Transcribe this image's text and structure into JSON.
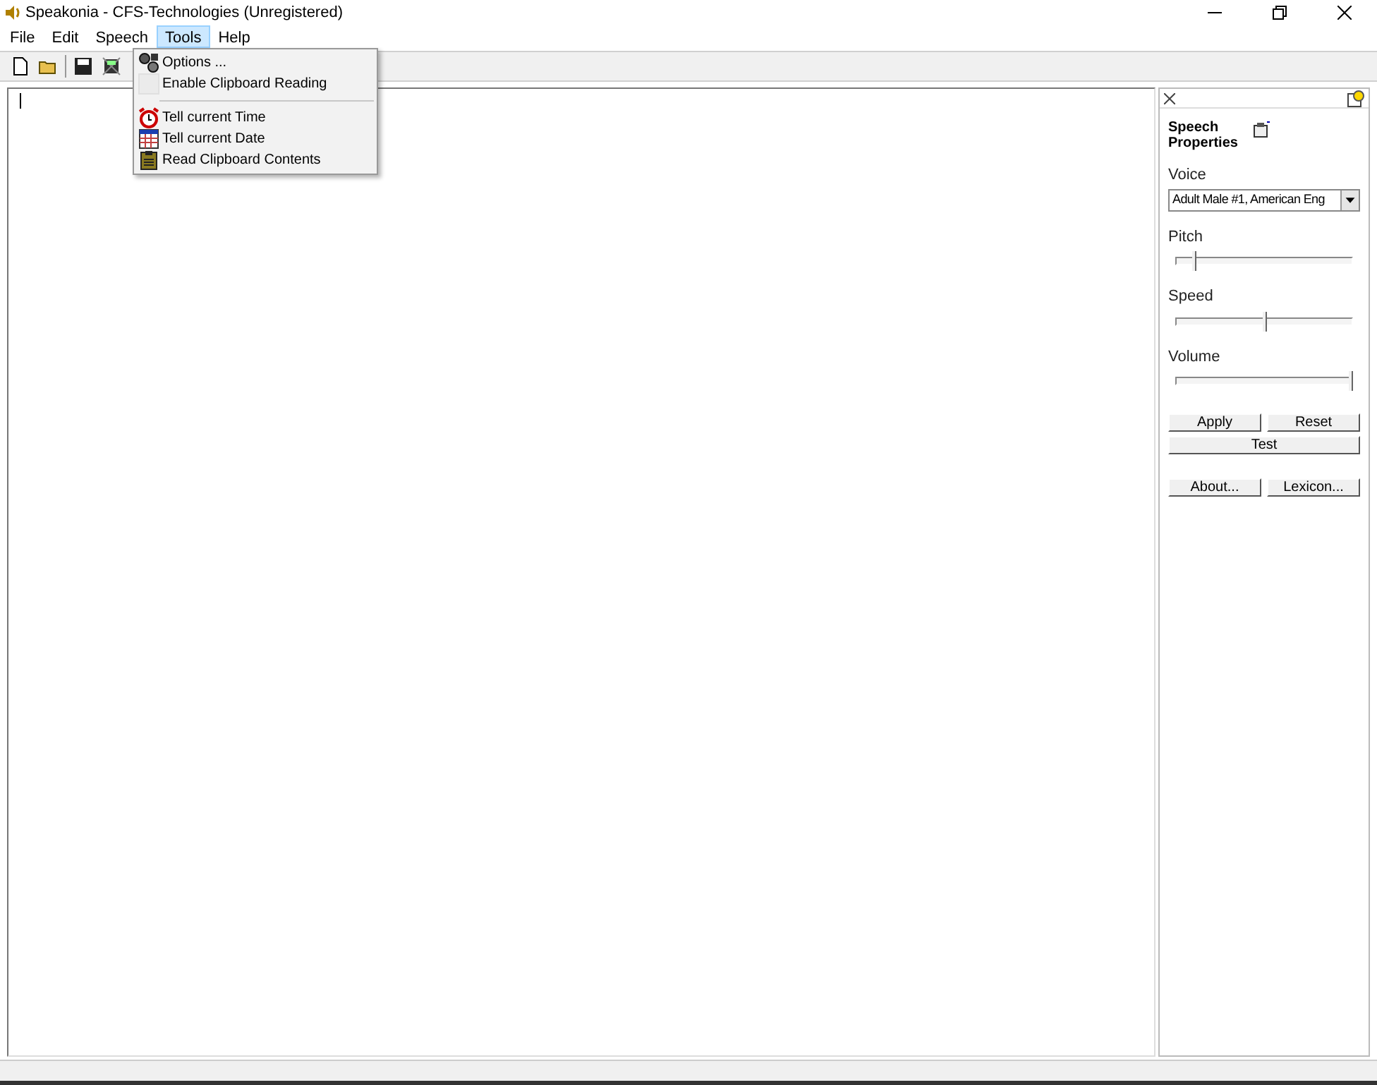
{
  "window": {
    "title": "Speakonia - CFS-Technologies (Unregistered)"
  },
  "menu": [
    {
      "label": "File",
      "selected": false
    },
    {
      "label": "Edit",
      "selected": false
    },
    {
      "label": "Speech",
      "selected": false
    },
    {
      "label": "Tools",
      "selected": true
    },
    {
      "label": "Help",
      "selected": false
    }
  ],
  "tools_menu": [
    {
      "kind": "command",
      "label": "Options ..."
    },
    {
      "kind": "checkbox",
      "label": "Enable Clipboard Reading",
      "checked": false
    },
    {
      "kind": "separator"
    },
    {
      "kind": "command",
      "label": "Tell current Time"
    },
    {
      "kind": "command",
      "label": "Tell current Date"
    },
    {
      "kind": "command",
      "label": "Read Clipboard Contents"
    }
  ],
  "panel": {
    "title": "Speech Properties",
    "voice_label": "Voice",
    "voice": "Adult Male #1, American Eng",
    "sliders": [
      {
        "label": "Pitch",
        "level": 0.1
      },
      {
        "label": "Speed",
        "level": 0.5
      },
      {
        "label": "Volume",
        "level": 1
      }
    ],
    "button_rows": [
      [
        "Apply",
        "Reset"
      ],
      [
        "Test"
      ],
      [
        "About...",
        "Lexicon..."
      ]
    ]
  }
}
